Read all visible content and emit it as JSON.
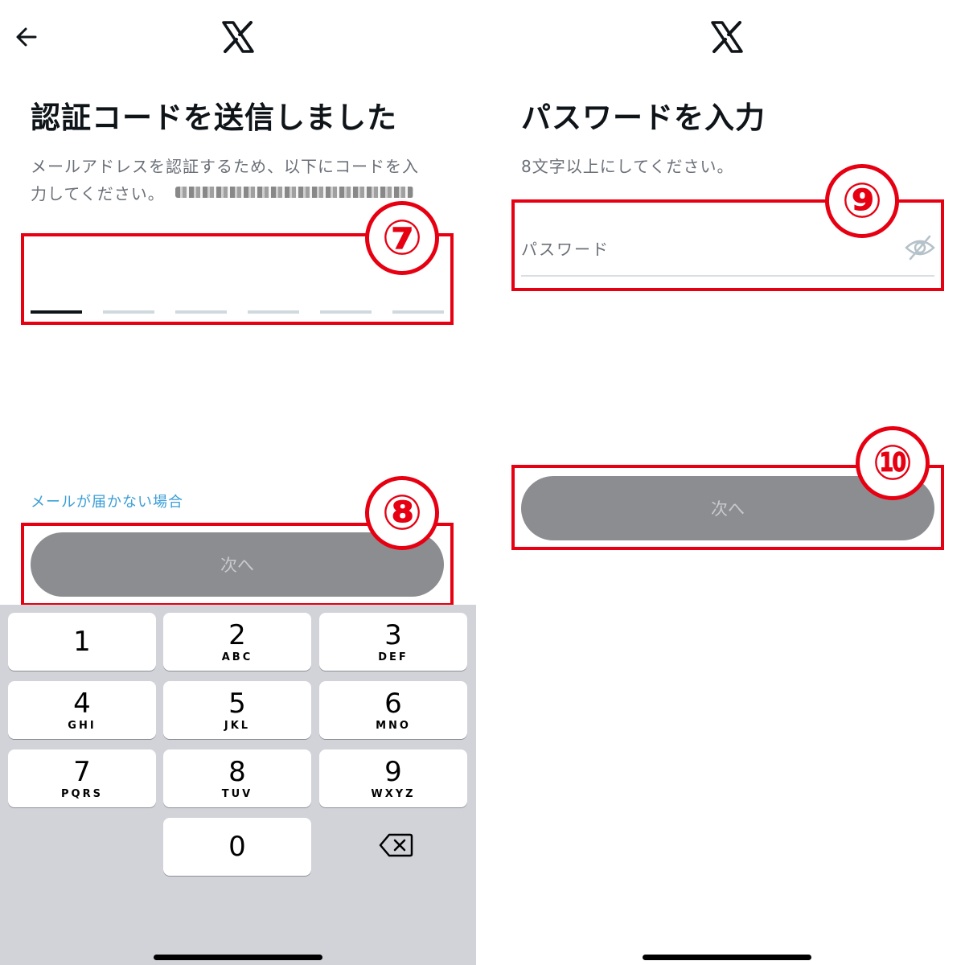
{
  "left": {
    "title": "認証コードを送信しました",
    "subtitle_line1": "メールアドレスを認証するため、以下にコードを入",
    "subtitle_line2": "力してください。",
    "code_slots": 6,
    "resend_link": "メールが届かない場合",
    "next_button": "次へ",
    "badge_code": "⑦",
    "badge_next": "⑧",
    "keyboard": {
      "keys": [
        {
          "digit": "1",
          "letters": ""
        },
        {
          "digit": "2",
          "letters": "ABC"
        },
        {
          "digit": "3",
          "letters": "DEF"
        },
        {
          "digit": "4",
          "letters": "GHI"
        },
        {
          "digit": "5",
          "letters": "JKL"
        },
        {
          "digit": "6",
          "letters": "MNO"
        },
        {
          "digit": "7",
          "letters": "PQRS"
        },
        {
          "digit": "8",
          "letters": "TUV"
        },
        {
          "digit": "9",
          "letters": "WXYZ"
        },
        {
          "digit": "0",
          "letters": ""
        }
      ]
    }
  },
  "right": {
    "title": "パスワードを入力",
    "subtitle": "8文字以上にしてください。",
    "password_placeholder": "パスワード",
    "next_button": "次へ",
    "badge_password": "⑨",
    "badge_next": "⑩"
  },
  "colors": {
    "annotation_red": "#e60012",
    "button_disabled": "#8c8d91",
    "link_blue": "#3b9ed6"
  },
  "icons": [
    "back-arrow-icon",
    "x-logo-icon",
    "eye-off-icon",
    "backspace-icon"
  ]
}
